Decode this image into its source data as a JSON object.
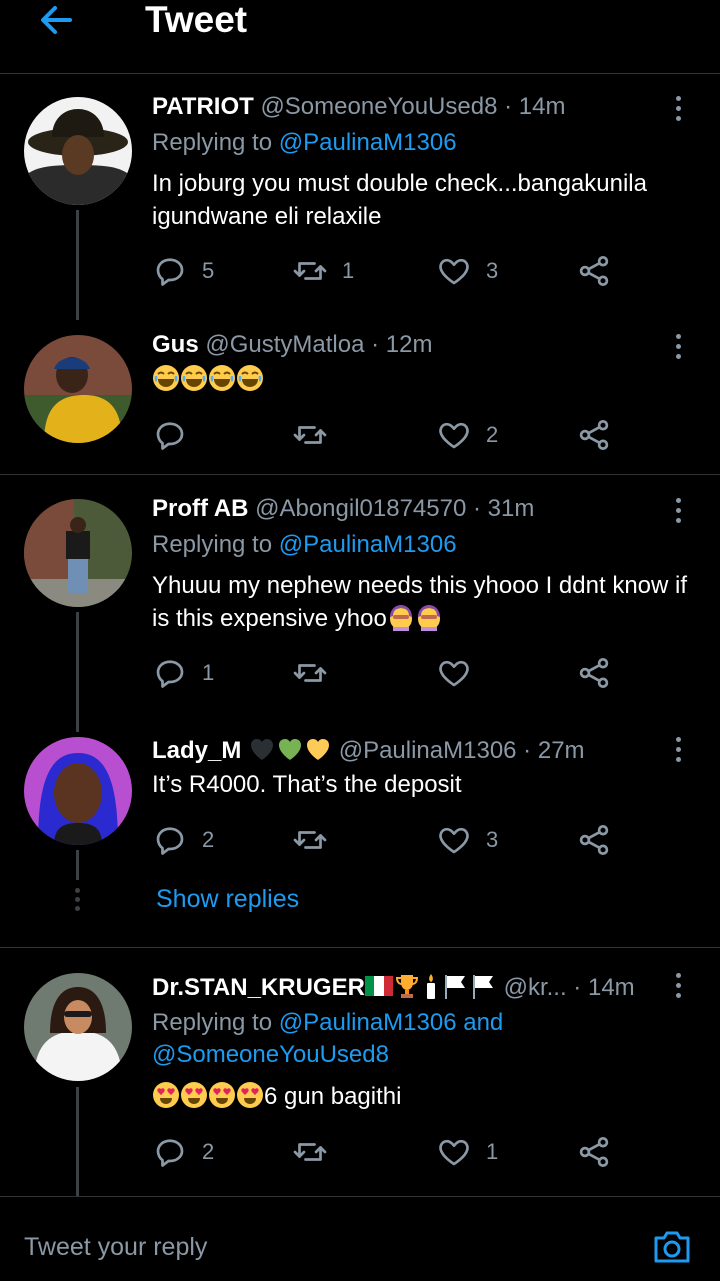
{
  "header": {
    "title": "Tweet"
  },
  "colors": {
    "accent": "#1d9bf0",
    "muted": "#8b98a5",
    "divider": "#2f3336",
    "background": "#000000"
  },
  "replies": [
    {
      "name": "PATRIOT",
      "handle": "@SomeoneYouUsed8",
      "sep": " · ",
      "time": "14m",
      "replying_label": "Replying to ",
      "replying_to": "@PaulinaM1306",
      "text": "In joburg you must double check...bangakunila igundwane eli relaxile",
      "stats": {
        "replies": "5",
        "retweets": "1",
        "likes": "3"
      }
    },
    {
      "name": "Gus",
      "handle": "@GustyMatloa",
      "sep": " · ",
      "time": "12m",
      "emoji": [
        "face-with-tears-of-joy",
        "face-with-tears-of-joy",
        "face-with-tears-of-joy",
        "face-with-tears-of-joy"
      ],
      "stats": {
        "replies": "",
        "retweets": "",
        "likes": "2"
      }
    },
    {
      "name": "Proff AB",
      "handle": "@Abongil01874570",
      "sep": " · ",
      "time": "31m",
      "replying_label": "Replying to ",
      "replying_to": "@PaulinaM1306",
      "text": "Yhuuu my nephew needs this yhooo I ddnt know if is this expensive yhoo",
      "text_emoji": [
        "woman-facepalming",
        "woman-facepalming"
      ],
      "stats": {
        "replies": "1",
        "retweets": "",
        "likes": ""
      }
    },
    {
      "name": "Lady_M",
      "name_emoji": [
        "black-heart",
        "green-heart",
        "yellow-heart"
      ],
      "handle": "@PaulinaM1306",
      "sep": " · ",
      "time": "27m",
      "text": "It’s R4000. That’s the deposit",
      "stats": {
        "replies": "2",
        "retweets": "",
        "likes": "3"
      }
    },
    {
      "name": "Dr.STAN_KRUGER",
      "name_emoji": [
        "italy-flag",
        "trophy",
        "candle",
        "white-flag",
        "white-flag"
      ],
      "handle": "@kr...",
      "sep": " · ",
      "time": "14m",
      "replying_label": "Replying to ",
      "replying_to": "@PaulinaM1306 and",
      "replying_to_2": "@SomeoneYouUsed8",
      "text_emoji": [
        "heart-eyes",
        "heart-eyes",
        "heart-eyes",
        "heart-eyes"
      ],
      "text": "6 gun bagithi",
      "stats": {
        "replies": "2",
        "retweets": "",
        "likes": "1"
      }
    }
  ],
  "show_replies": "Show replies",
  "composer": {
    "placeholder": "Tweet your reply"
  },
  "icons": [
    "back-arrow-icon",
    "more-icon",
    "reply-icon",
    "retweet-icon",
    "like-icon",
    "share-icon",
    "camera-icon"
  ]
}
